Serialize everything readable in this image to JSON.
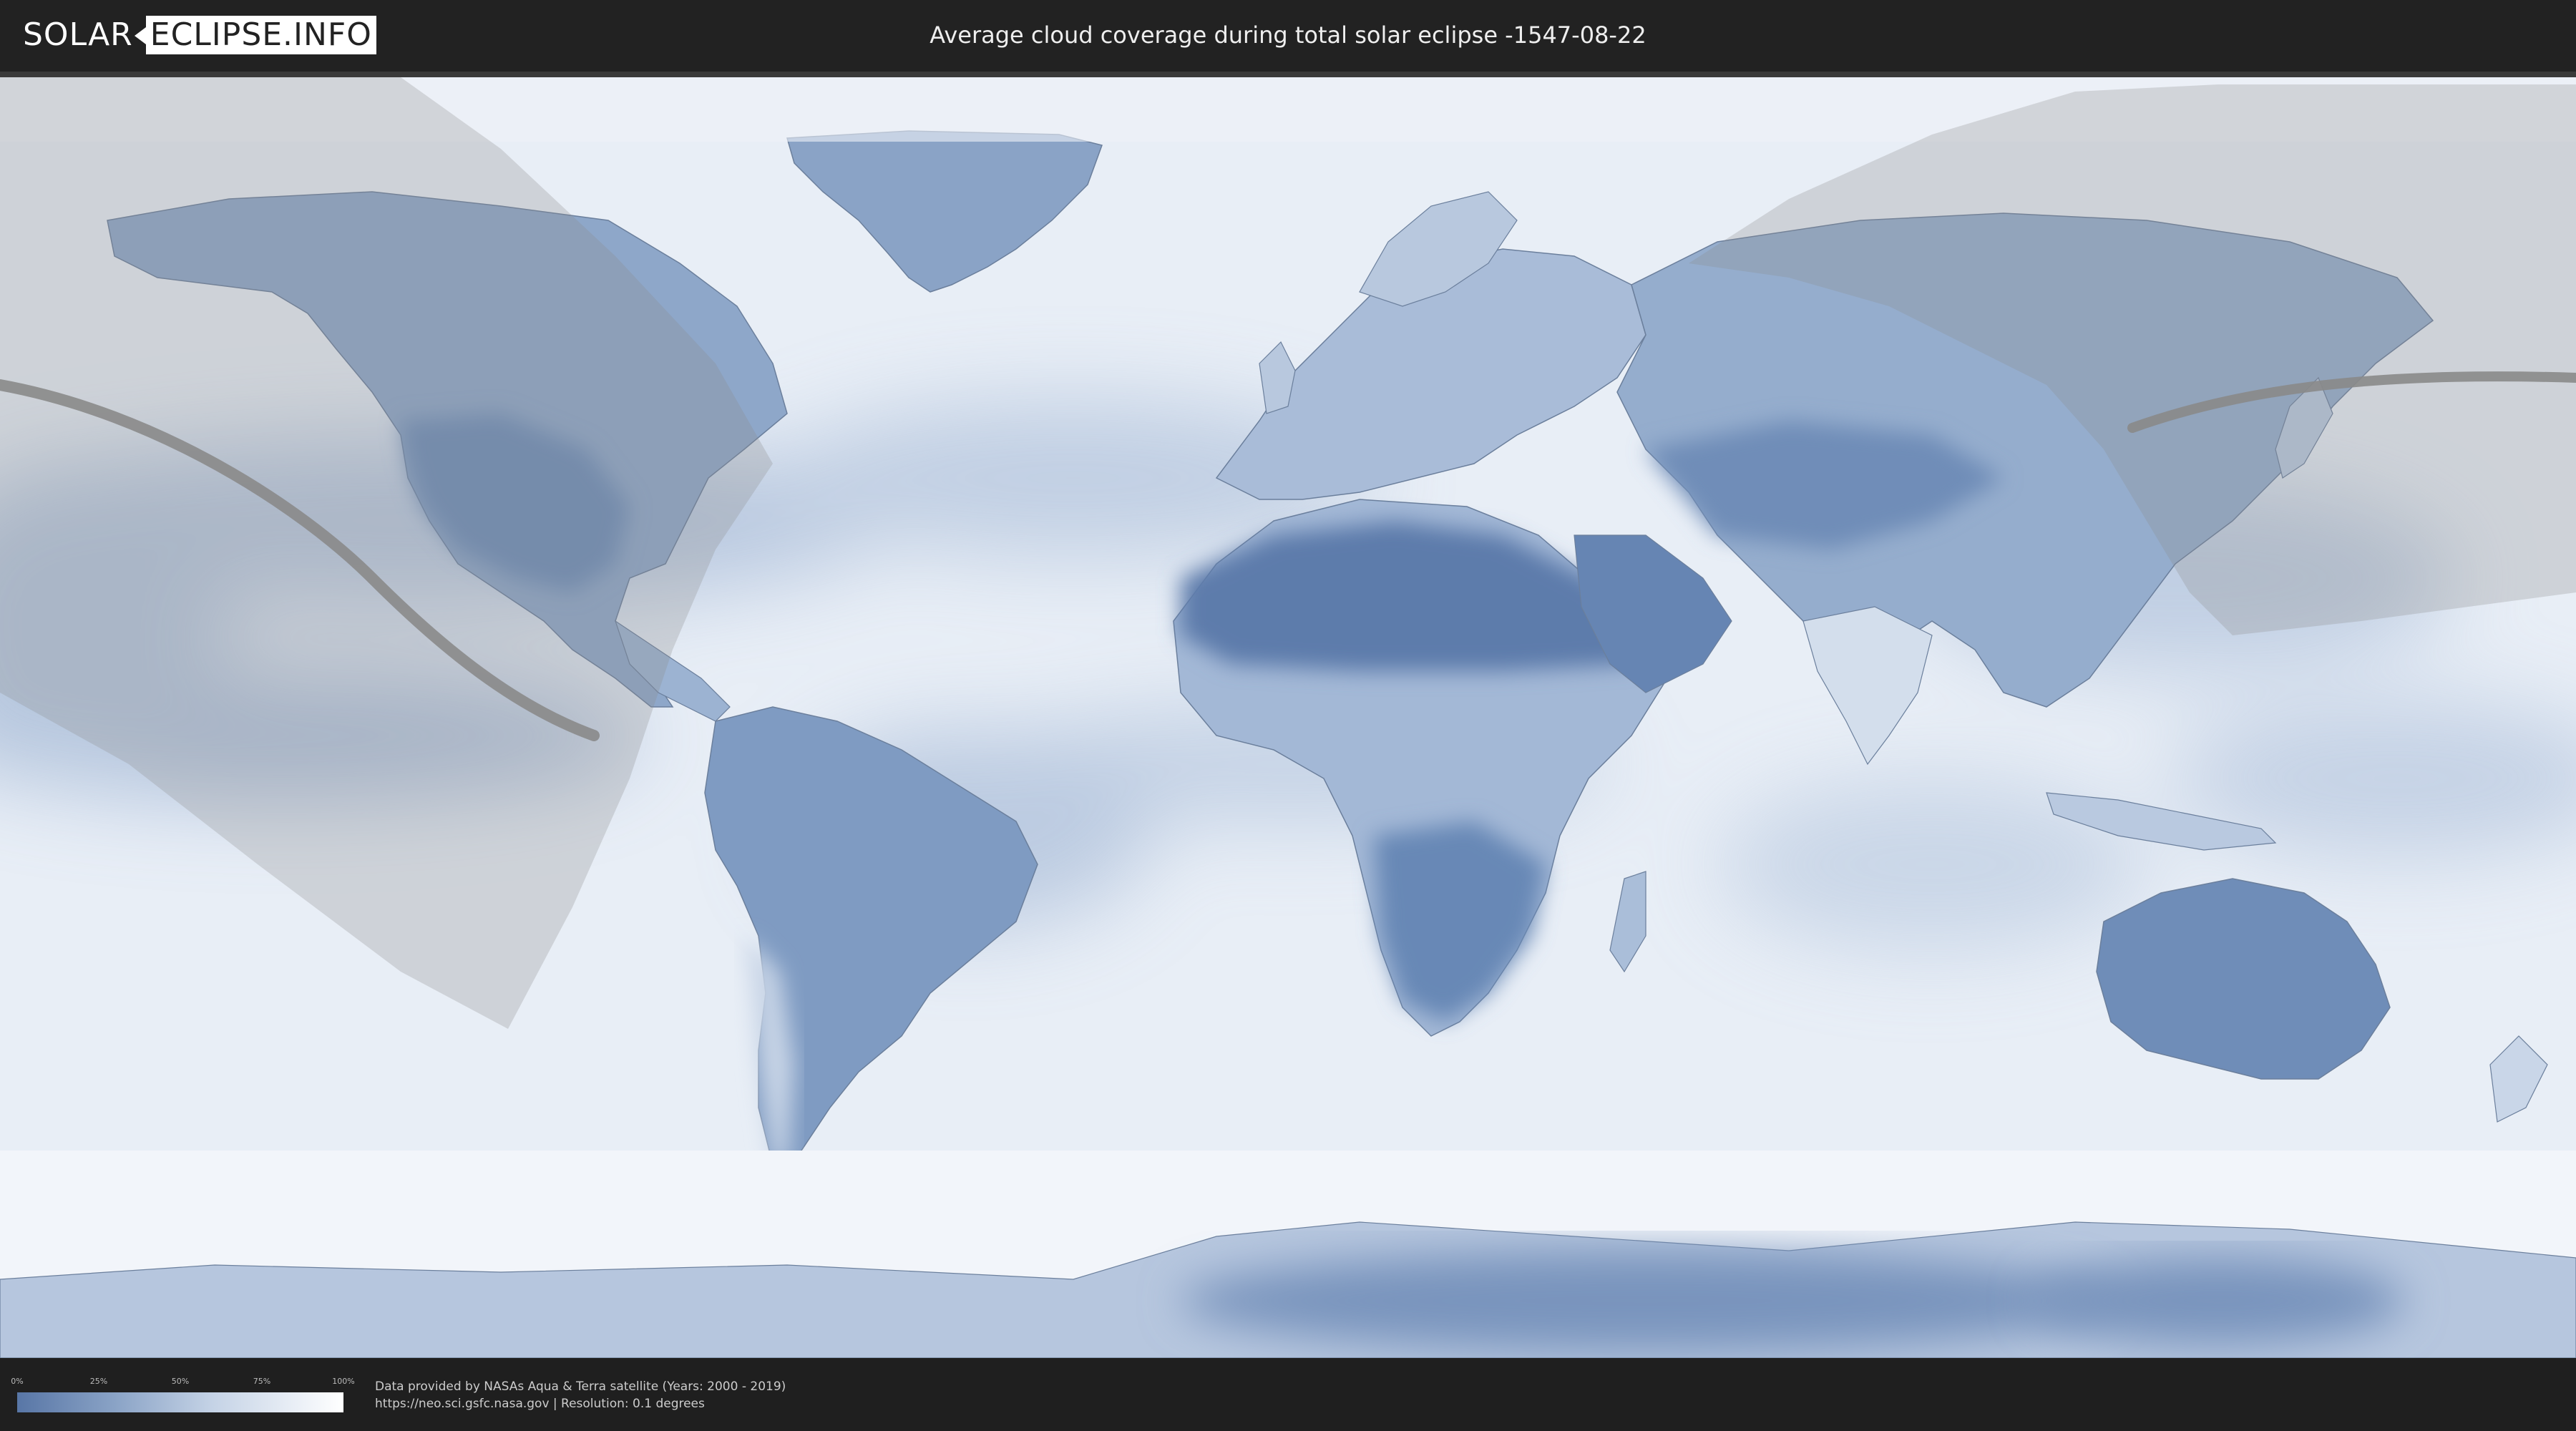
{
  "header": {
    "logo_left": "SOLAR",
    "logo_right": "ECLIPSE.INFO",
    "title": "Average cloud coverage during total solar eclipse -1547-08-22"
  },
  "legend": {
    "labels": [
      "0%",
      "25%",
      "50%",
      "75%",
      "100%"
    ],
    "colors": {
      "low": "#5876a6",
      "high": "#ffffff"
    }
  },
  "footer": {
    "credit_line1": "Data provided by NASAs Aqua & Terra satellite (Years: 2000 - 2019)",
    "credit_line2": "https://neo.sci.gsfc.nasa.gov | Resolution: 0.1 degrees"
  },
  "map": {
    "colors": {
      "ocean_cloudy": "#e8eef6",
      "clear_land": "#6f8db8",
      "eclipse_shadow": "#8c8c8c",
      "path_line": "#8a8a8a"
    }
  }
}
